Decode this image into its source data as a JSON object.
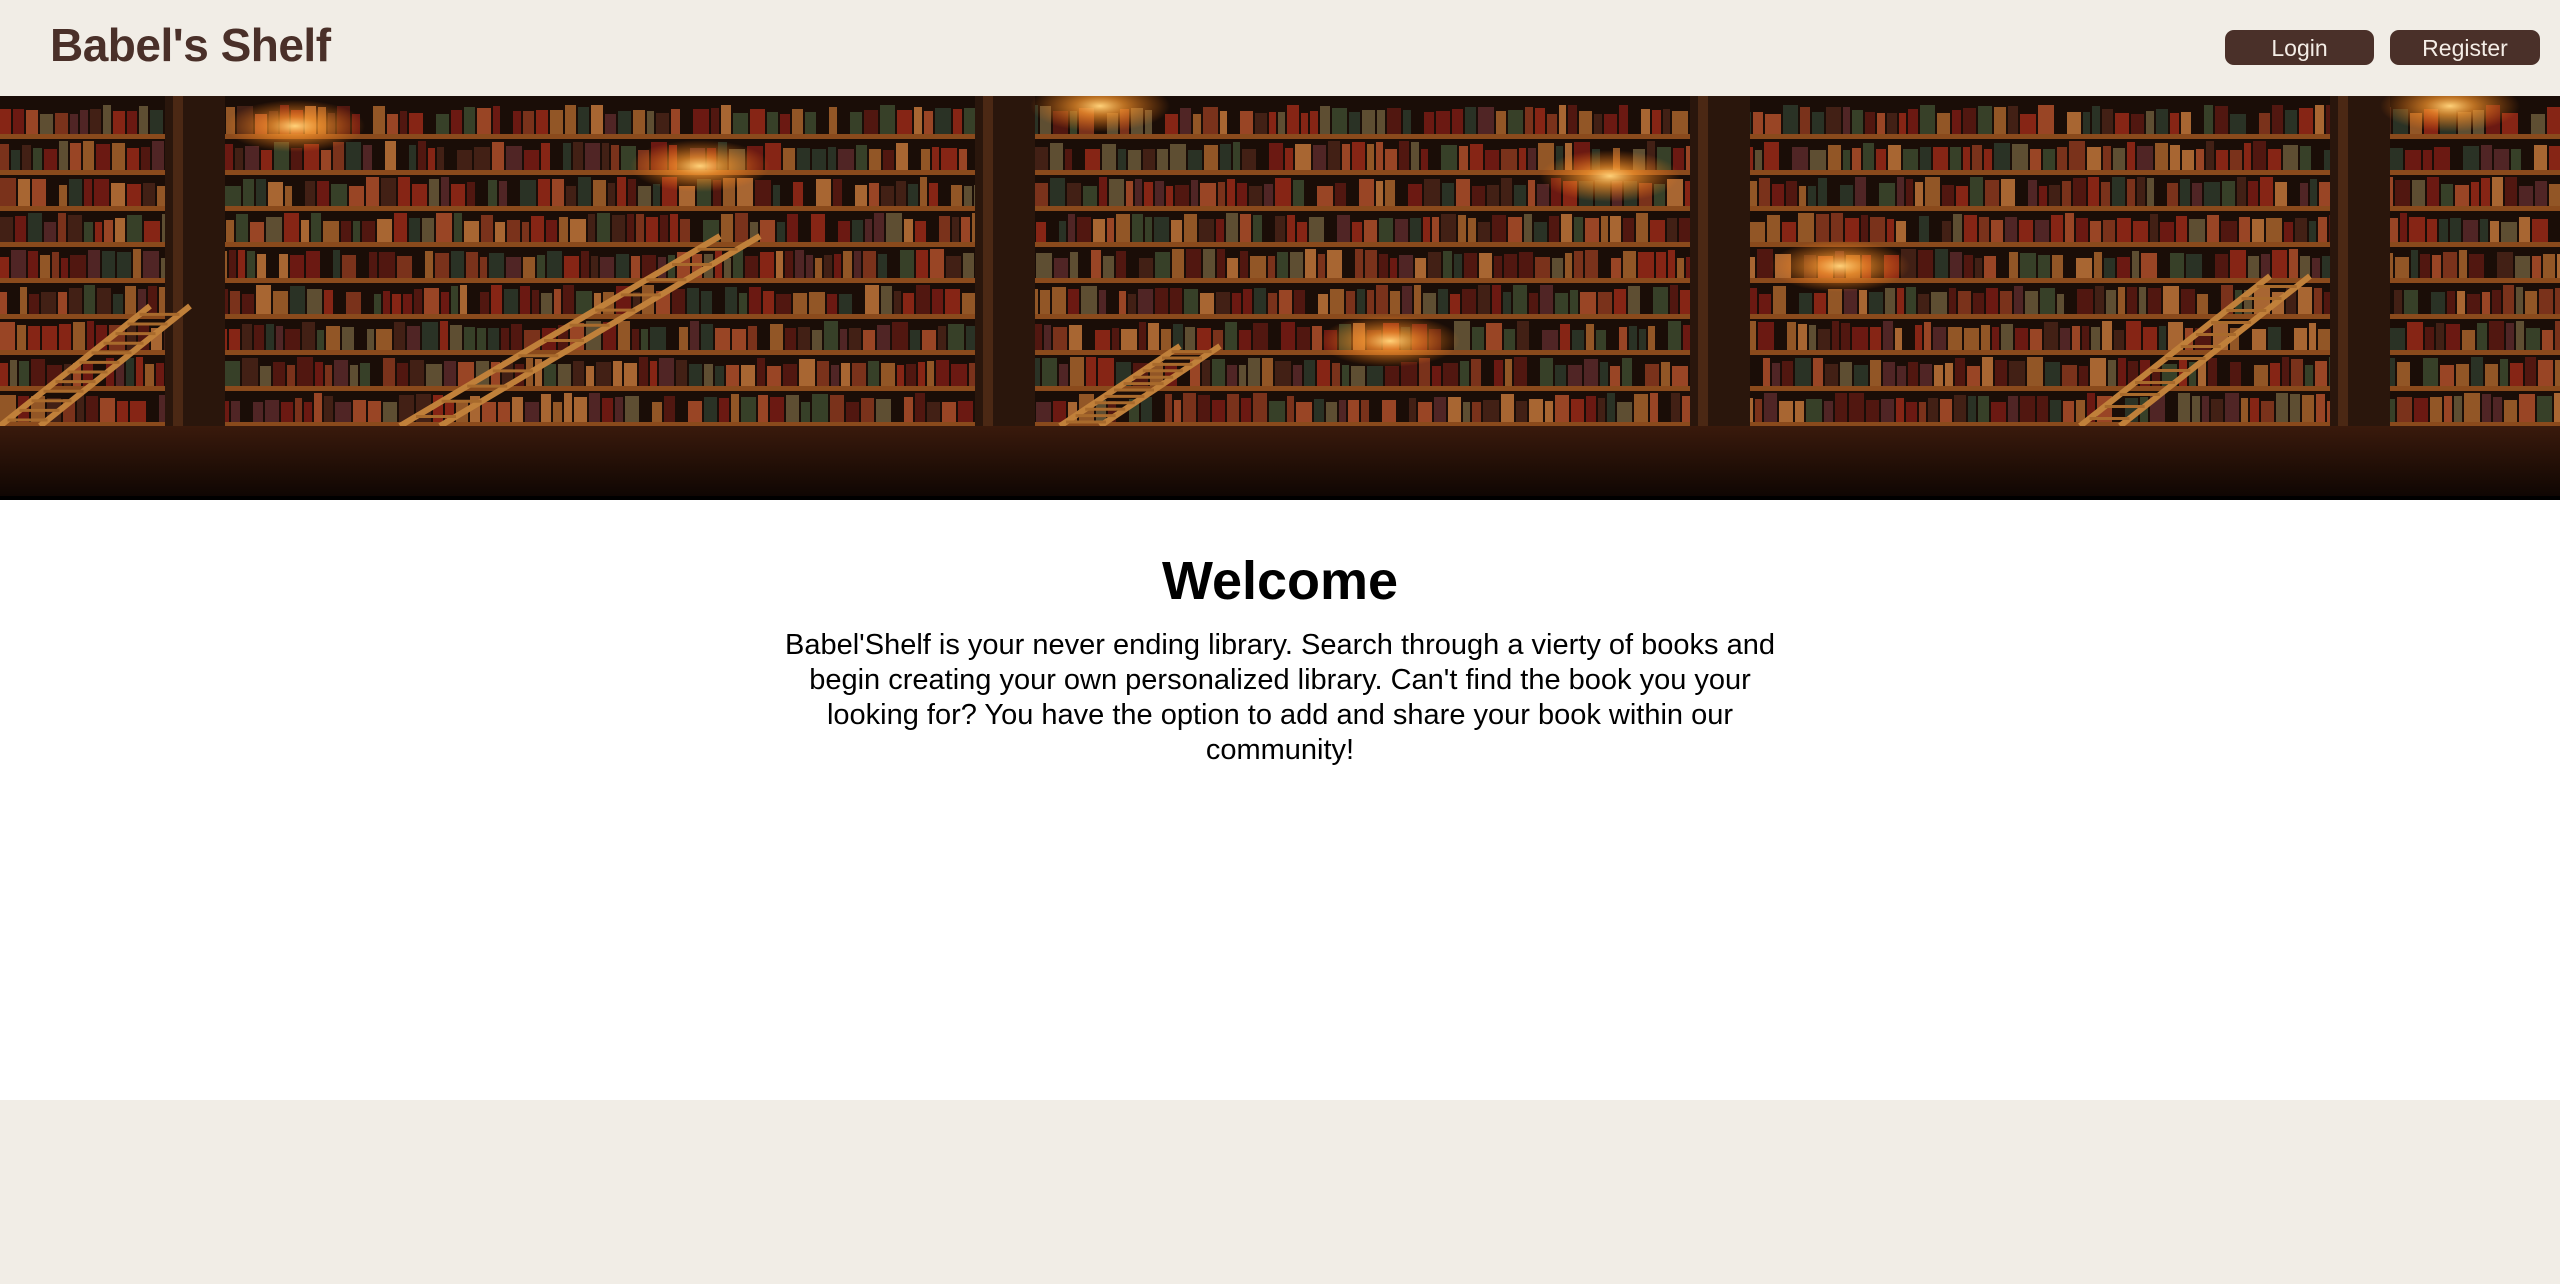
{
  "header": {
    "brand": "Babel's Shelf",
    "login_label": "Login",
    "register_label": "Register"
  },
  "banner": {
    "description_icon": "library-bookshelf-image"
  },
  "main": {
    "title": "Welcome",
    "text": "Babel'Shelf is your never ending library. Search through a vierty of books and begin creating your own personalized library. Can't find the book you your looking for? You have the option to add and share your book within our community!"
  },
  "colors": {
    "brand": "#4a3029",
    "background": "#f1ede6",
    "button_text": "#f4ede6",
    "content_bg": "#ffffff"
  }
}
